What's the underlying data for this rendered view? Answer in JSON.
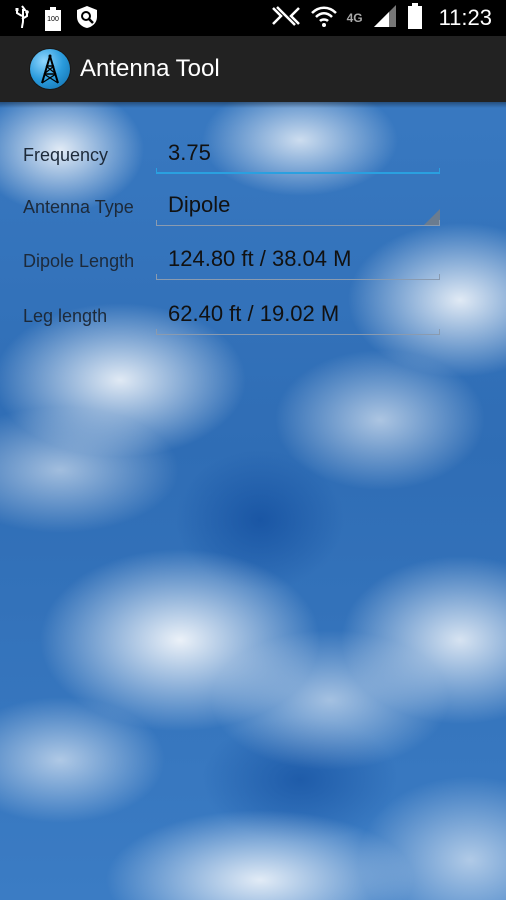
{
  "status_bar": {
    "battery_label": "100",
    "time": "11:23",
    "network_label": "4G"
  },
  "app": {
    "title": "Antenna Tool",
    "icon": "antenna-tower-icon",
    "accent_color": "#2aa0e0"
  },
  "form": {
    "frequency": {
      "label": "Frequency",
      "value": "3.75"
    },
    "antenna_type": {
      "label": "Antenna Type",
      "value": "Dipole"
    },
    "dipole_length": {
      "label": "Dipole Length",
      "value": "124.80 ft / 38.04 M"
    },
    "leg_length": {
      "label": "Leg length",
      "value": "62.40 ft / 19.02 M"
    }
  }
}
